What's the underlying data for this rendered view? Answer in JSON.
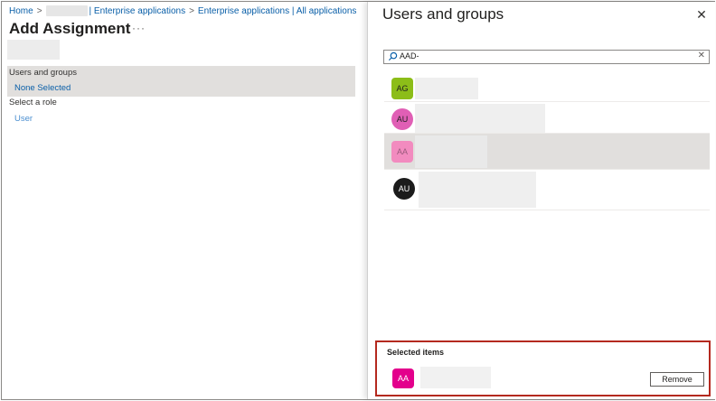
{
  "breadcrumb": {
    "home": "Home",
    "sep": ">",
    "item2": "| Enterprise applications",
    "item3": "Enterprise applications | All applications"
  },
  "page": {
    "title": "Add Assignment",
    "more": "···"
  },
  "assignment": {
    "users_groups_label": "Users and groups",
    "users_groups_value": "None Selected",
    "role_label": "Select a role",
    "role_value": "User"
  },
  "panel": {
    "title": "Users and groups",
    "close_icon": "close-icon",
    "search": {
      "value": "AAD-",
      "icon": "search-icon",
      "clear_icon": "clear-icon"
    },
    "results": [
      {
        "initials": "AG",
        "color": "#8cbd18",
        "shape": "square",
        "text_color": "#201f1e",
        "selected": false
      },
      {
        "initials": "AU",
        "color": "#e05fb5",
        "shape": "circle",
        "text_color": "#201f1e",
        "selected": false
      },
      {
        "initials": "AA",
        "color": "#f28bbf",
        "shape": "square",
        "text_color": "#9b5a7c",
        "selected": true
      },
      {
        "initials": "AU",
        "color": "#1b1b1b",
        "shape": "circle",
        "text_color": "#ffffff",
        "selected": false
      }
    ]
  },
  "selected_items": {
    "title": "Selected items",
    "item_initials": "AA",
    "item_color": "#e3008c",
    "remove_label": "Remove"
  },
  "colors": {
    "link": "#0a5fa8",
    "highlight_border": "#b4291f",
    "selected_row": "#e1dfdd"
  }
}
